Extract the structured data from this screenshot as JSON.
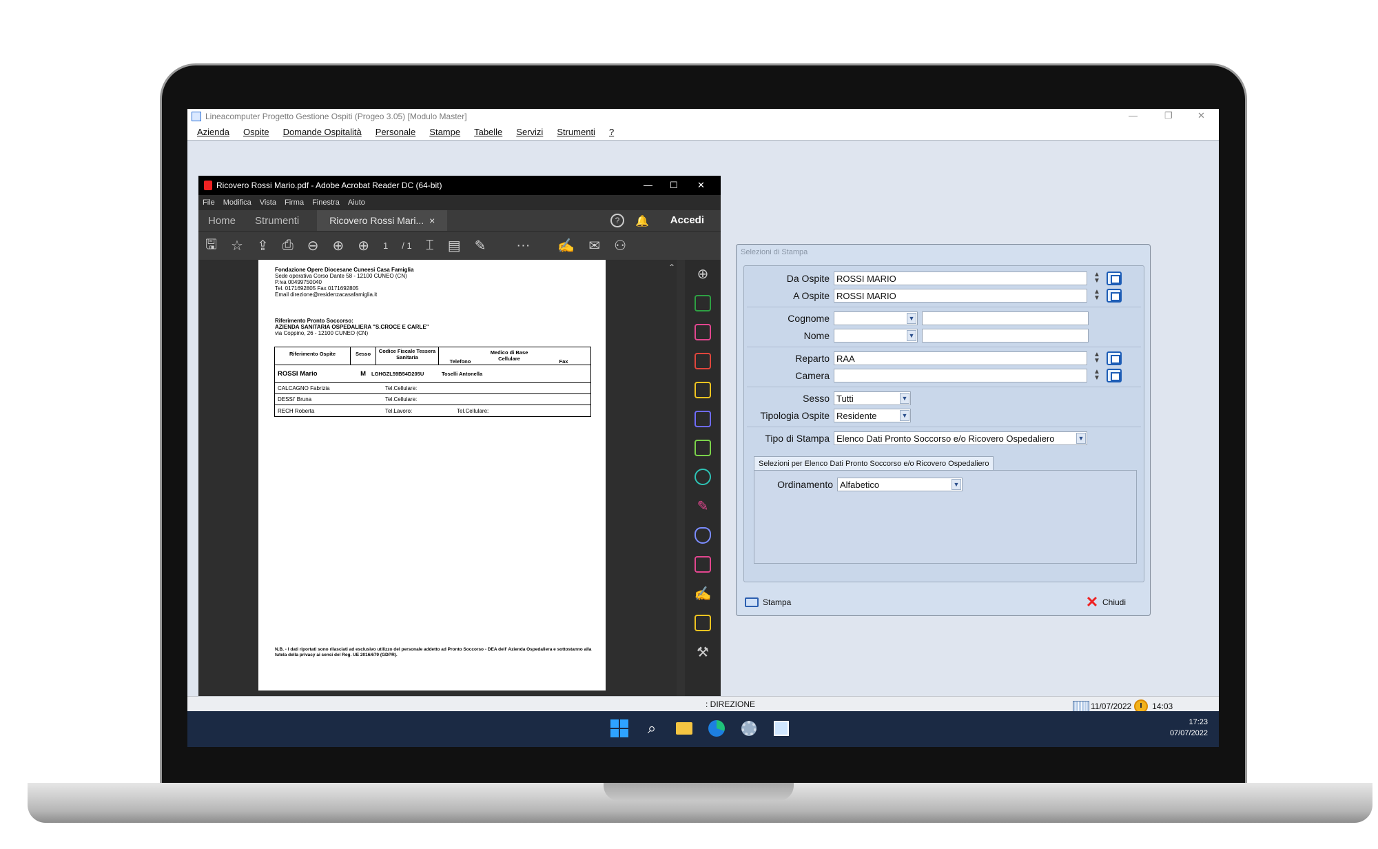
{
  "app": {
    "title": "Lineacomputer Progetto Gestione Ospiti (Progeo 3.05) [Modulo Master]",
    "menu": [
      "Azienda",
      "Ospite",
      "Domande Ospitalità",
      "Personale",
      "Stampe",
      "Tabelle",
      "Servizi",
      "Strumenti",
      "?"
    ],
    "status_user": ": DIREZIONE",
    "status_date": "11/07/2022",
    "status_time": "14:03"
  },
  "taskbar": {
    "time": "17:23",
    "date": "07/07/2022"
  },
  "acrobat": {
    "title": "Ricovero Rossi Mario.pdf - Adobe Acrobat Reader DC (64-bit)",
    "menu": [
      "File",
      "Modifica",
      "Vista",
      "Firma",
      "Finestra",
      "Aiuto"
    ],
    "tab_home": "Home",
    "tab_tools": "Strumenti",
    "tab_doc": "Ricovero Rossi Mari...",
    "tab_close": "×",
    "login": "Accedi",
    "page_current": "1",
    "page_total": "/ 1",
    "more": "···"
  },
  "pdf": {
    "org_name": "Fondazione Opere Diocesane Cuneesi Casa Famiglia",
    "org_address": "Sede operativa Corso Dante 58 - 12100 CUNEO (CN)",
    "org_vat": "P.iva 00499750040",
    "org_phone": "Tel. 0171692805   Fax 0171692805",
    "org_email": "Email direzione@residenzacasafamiglia.it",
    "ref_label": "Riferimento Pronto Soccorso:",
    "hospital": "AZIENDA SANITARIA OSPEDALIERA \"S.CROCE E CARLE\"",
    "hospital_address": "via Coppino, 26 - 12100 CUNEO (CN)",
    "headers": [
      "Riferimento Ospite",
      "Sesso",
      "Codice Fiscale Tessera Sanitaria",
      "Telefono",
      "Medico di Base Cellulare",
      "Fax"
    ],
    "guest_name": "ROSSI Mario",
    "guest_sex": "M",
    "guest_cf": "LGHGZL59B54D205U",
    "guest_doctor": "Toselli Antonella",
    "contacts": [
      {
        "name": "CALCAGNO Fabrizia",
        "c1": "Tel.Cellulare:",
        "c2": ""
      },
      {
        "name": "DESSI' Bruna",
        "c1": "Tel.Cellulare:",
        "c2": ""
      },
      {
        "name": "RECH Roberta",
        "c1": "Tel.Lavoro:",
        "c2": "Tel.Cellulare:"
      }
    ],
    "footnote": "N.B. - I dati riportati sono rilasciati ad esclusivo utilizzo del personale addetto ad Pronto Soccorso - DEA dell' Azienda Ospedaliera e sottostanno alla tutela della privacy ai sensi del Reg. UE 2016/679 (GDPR)."
  },
  "dialog": {
    "title": "Selezioni di Stampa",
    "da_ospite_label": "Da Ospite",
    "da_ospite_value": "ROSSI MARIO",
    "a_ospite_label": "A Ospite",
    "a_ospite_value": "ROSSI MARIO",
    "cognome_label": "Cognome",
    "nome_label": "Nome",
    "reparto_label": "Reparto",
    "reparto_value": "RAA",
    "camera_label": "Camera",
    "sesso_label": "Sesso",
    "sesso_value": "Tutti",
    "tipologia_label": "Tipologia Ospite",
    "tipologia_value": "Residente",
    "tipo_stampa_label": "Tipo di Stampa",
    "tipo_stampa_value": "Elenco Dati Pronto Soccorso e/o Ricovero Ospedaliero",
    "subtab_label": "Selezioni per Elenco Dati Pronto Soccorso e/o Ricovero Ospedaliero",
    "ordinamento_label": "Ordinamento",
    "ordinamento_value": "Alfabetico",
    "print_label": "Stampa",
    "close_label": "Chiudi"
  }
}
